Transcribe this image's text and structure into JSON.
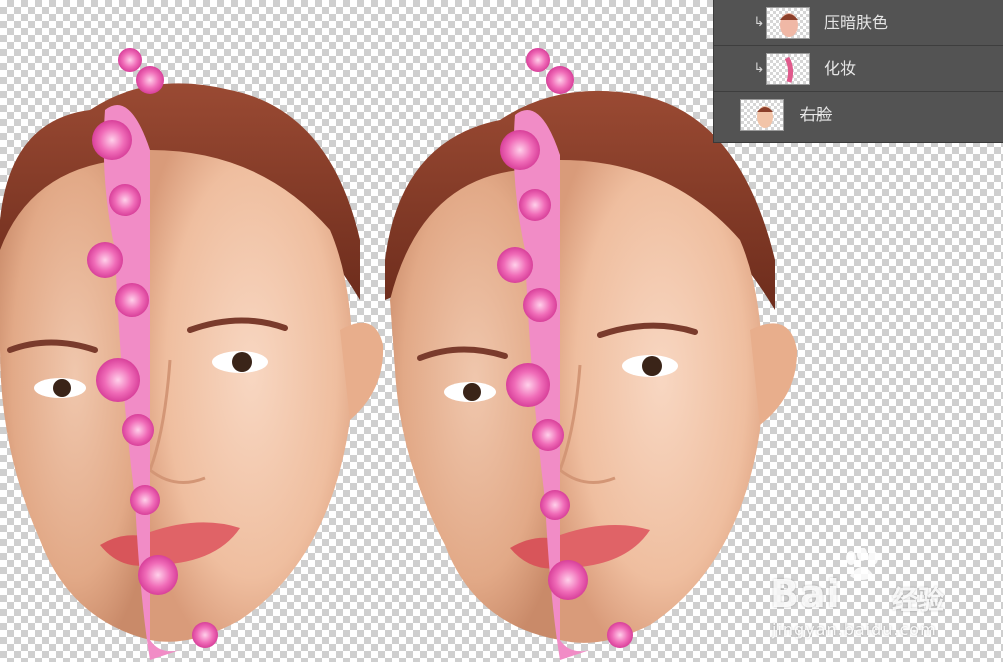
{
  "layers_panel": {
    "layers": [
      {
        "name": "压暗肤色",
        "clipped": true,
        "visible_name_style": "normal"
      },
      {
        "name": "化妆",
        "clipped": true,
        "visible_name_style": "normal"
      },
      {
        "name": "右脸",
        "clipped": false,
        "visible_name_style": "strikethrough"
      }
    ]
  },
  "watermark": {
    "brand": "Bai",
    "brand_suffix": "经验",
    "url": "jingyan.baidu.com"
  },
  "colors": {
    "panel_bg": "#535353",
    "skin": "#f2c4a8",
    "hair": "#8b3f2a",
    "flower": "#ee5fb0",
    "lips": "#d8555a"
  },
  "icons": [
    "clip-arrow-icon",
    "layer-thumbnail-icon",
    "baidu-paw-icon"
  ]
}
